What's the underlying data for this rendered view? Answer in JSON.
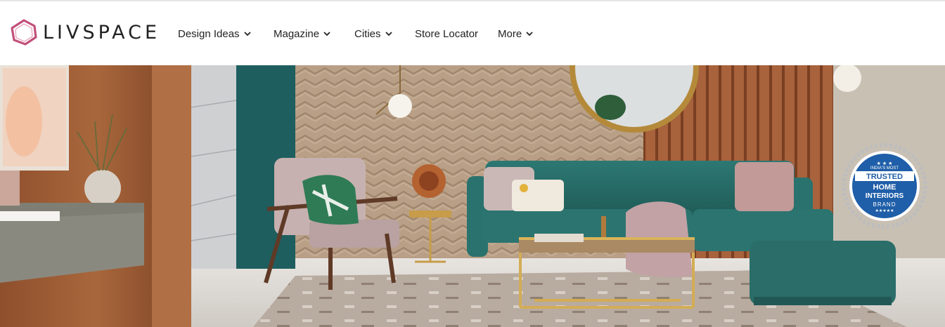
{
  "brand": {
    "name": "LIVSPACE",
    "accent_color": "#c2507a",
    "logo_icon": "hexagon-ring-icon"
  },
  "nav": {
    "items": [
      {
        "label": "Design Ideas",
        "has_dropdown": true
      },
      {
        "label": "Magazine",
        "has_dropdown": true
      },
      {
        "label": "Cities",
        "has_dropdown": true
      },
      {
        "label": "Store Locator",
        "has_dropdown": false
      },
      {
        "label": "More",
        "has_dropdown": true
      }
    ],
    "dropdown_icon": "chevron-down-icon"
  },
  "hero": {
    "badge": {
      "line1": "INDIA'S MOST",
      "line2": "TRUSTED",
      "line3": "HOME",
      "line4": "INTERIORS",
      "line5": "BRAND",
      "stars": "★★★★★",
      "top_stars": "★ ★ ★",
      "color": "#1f5ea8"
    }
  }
}
